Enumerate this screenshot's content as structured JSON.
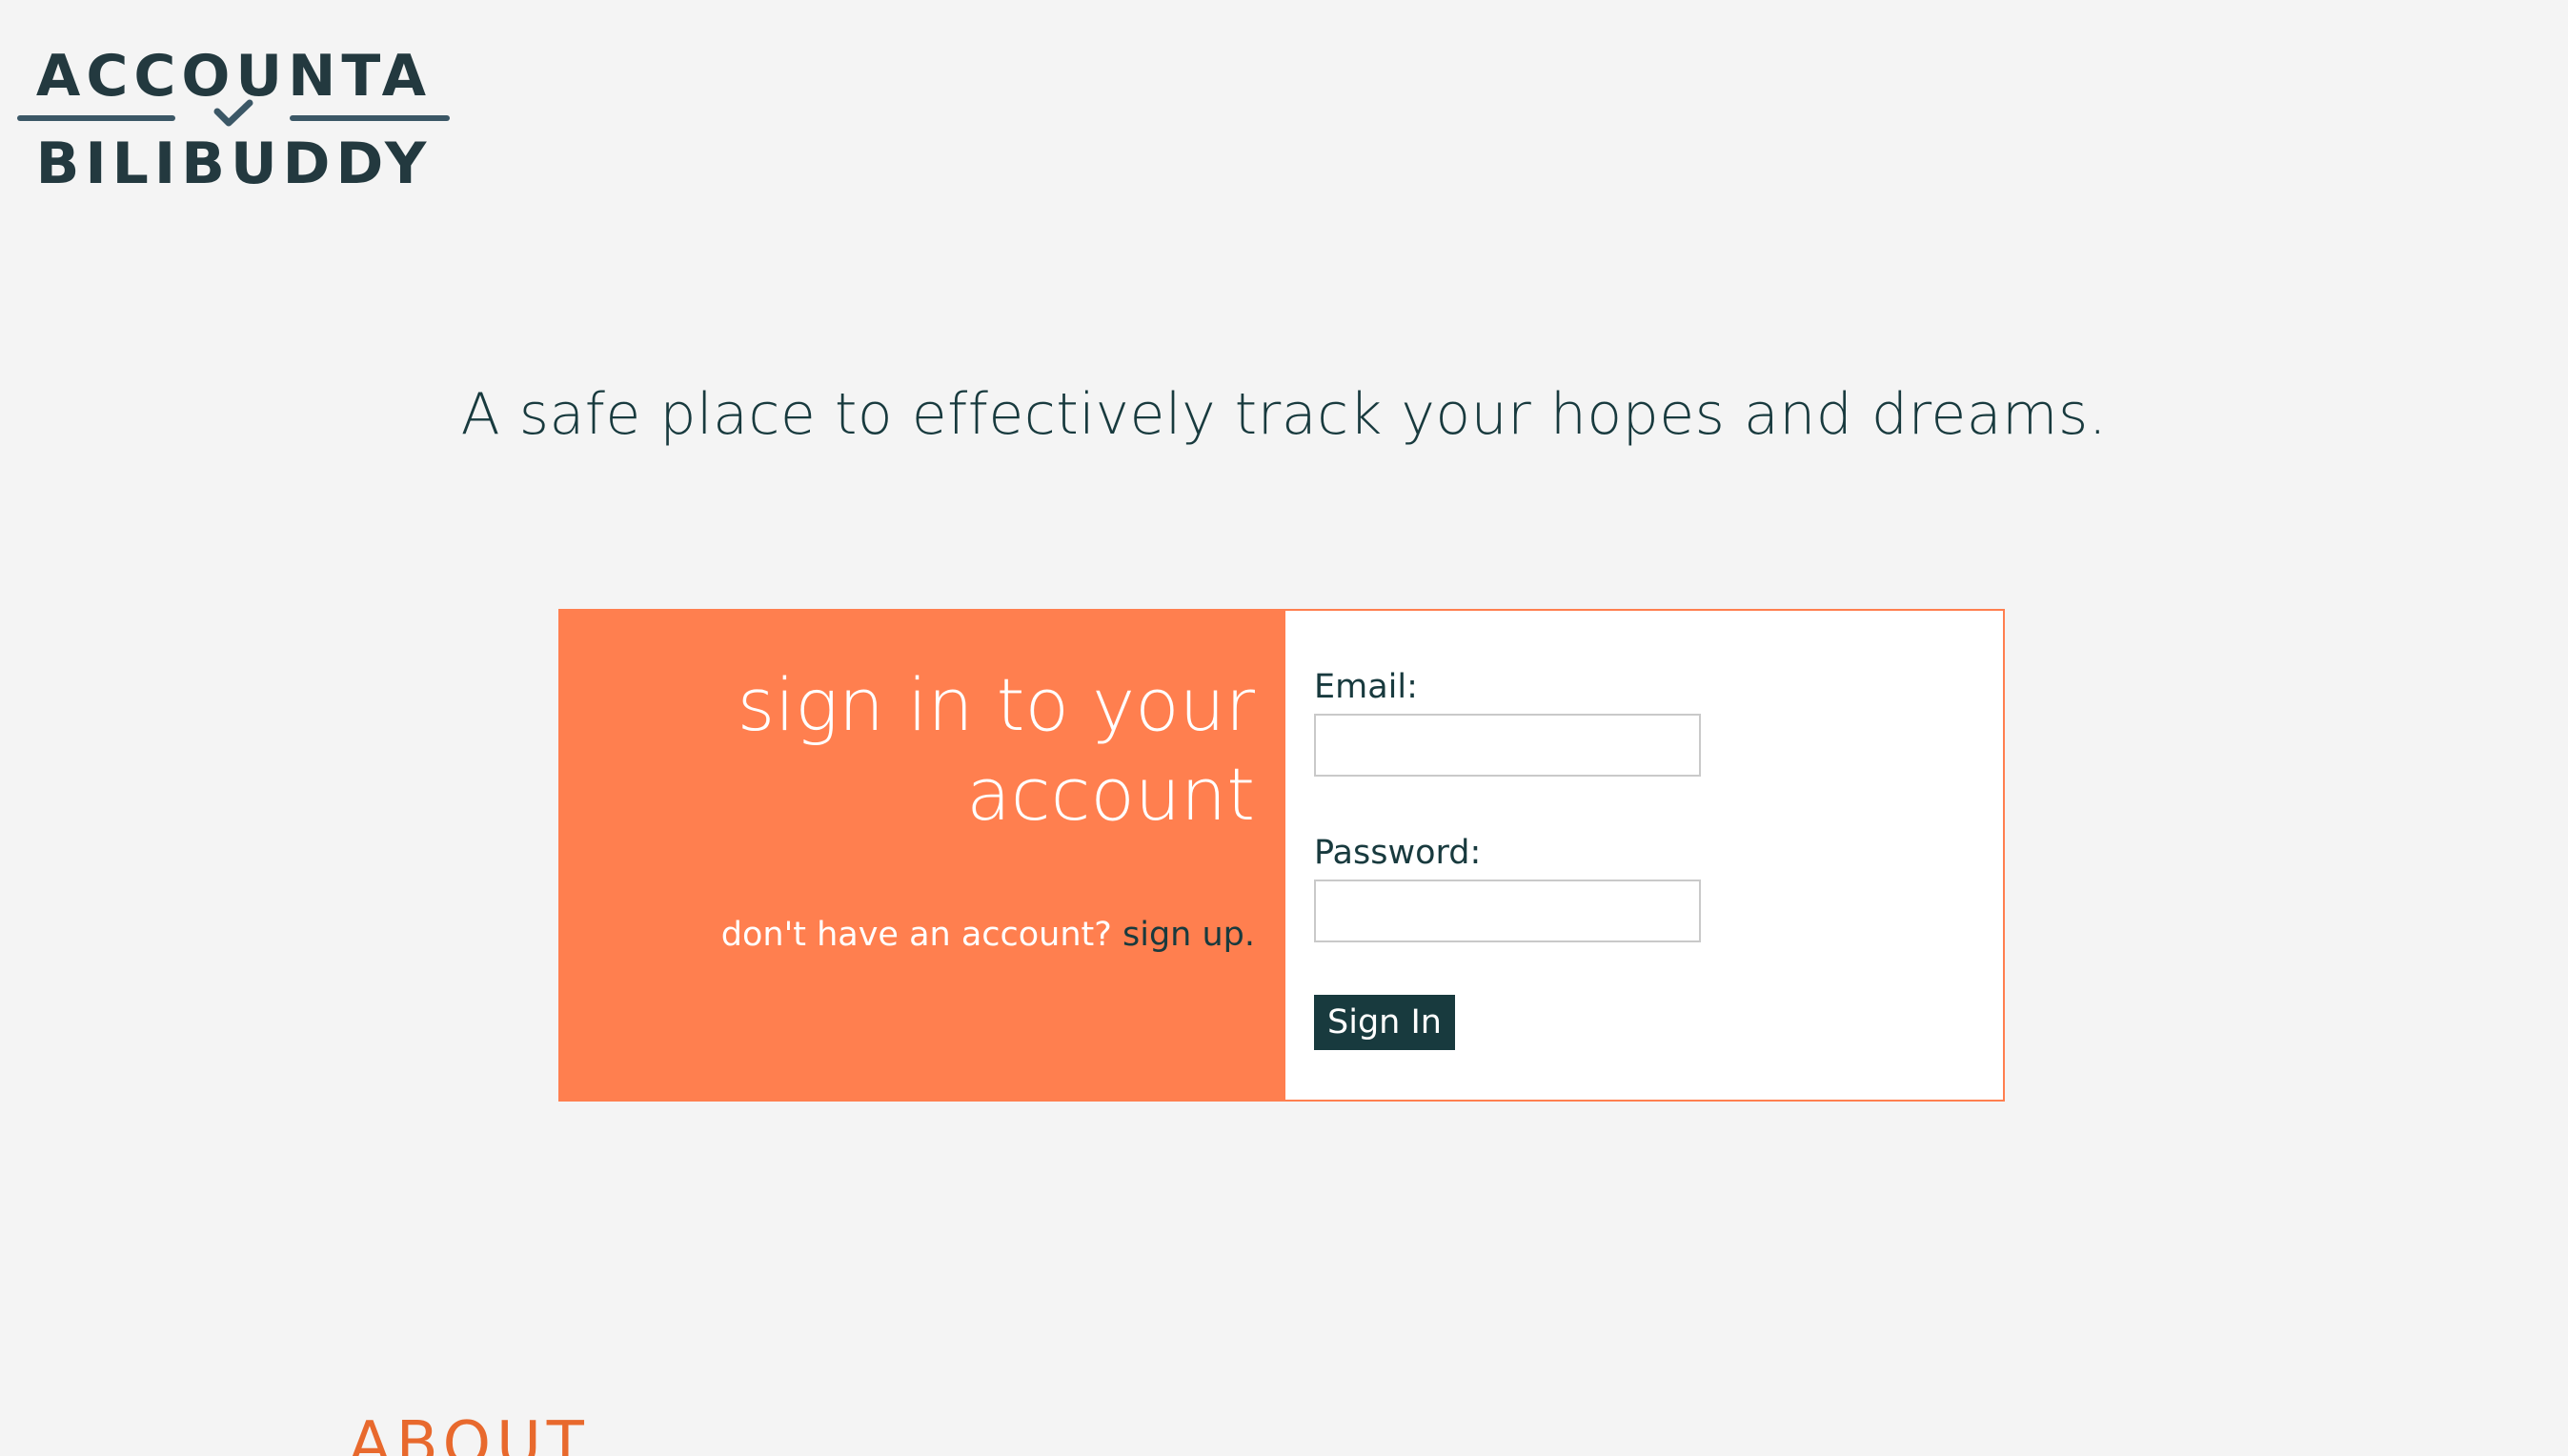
{
  "logo": {
    "top_word": "ACCOUNTA",
    "bottom_word": "BILIBUDDY",
    "icon": "checkmark-icon"
  },
  "tagline": "A safe place to effectively track your hopes and dreams.",
  "signin_card": {
    "heading": "sign in to your account",
    "signup_prompt": "don't have an account?",
    "signup_link": "sign up.",
    "email_label": "Email:",
    "email_value": "",
    "password_label": "Password:",
    "password_value": "",
    "submit_label": "Sign In"
  },
  "about_heading": "ABOUT",
  "colors": {
    "accent_orange": "#ff7f4f",
    "dark_teal": "#183a3e",
    "about_orange": "#e8692d",
    "background": "#f4f4f4"
  }
}
